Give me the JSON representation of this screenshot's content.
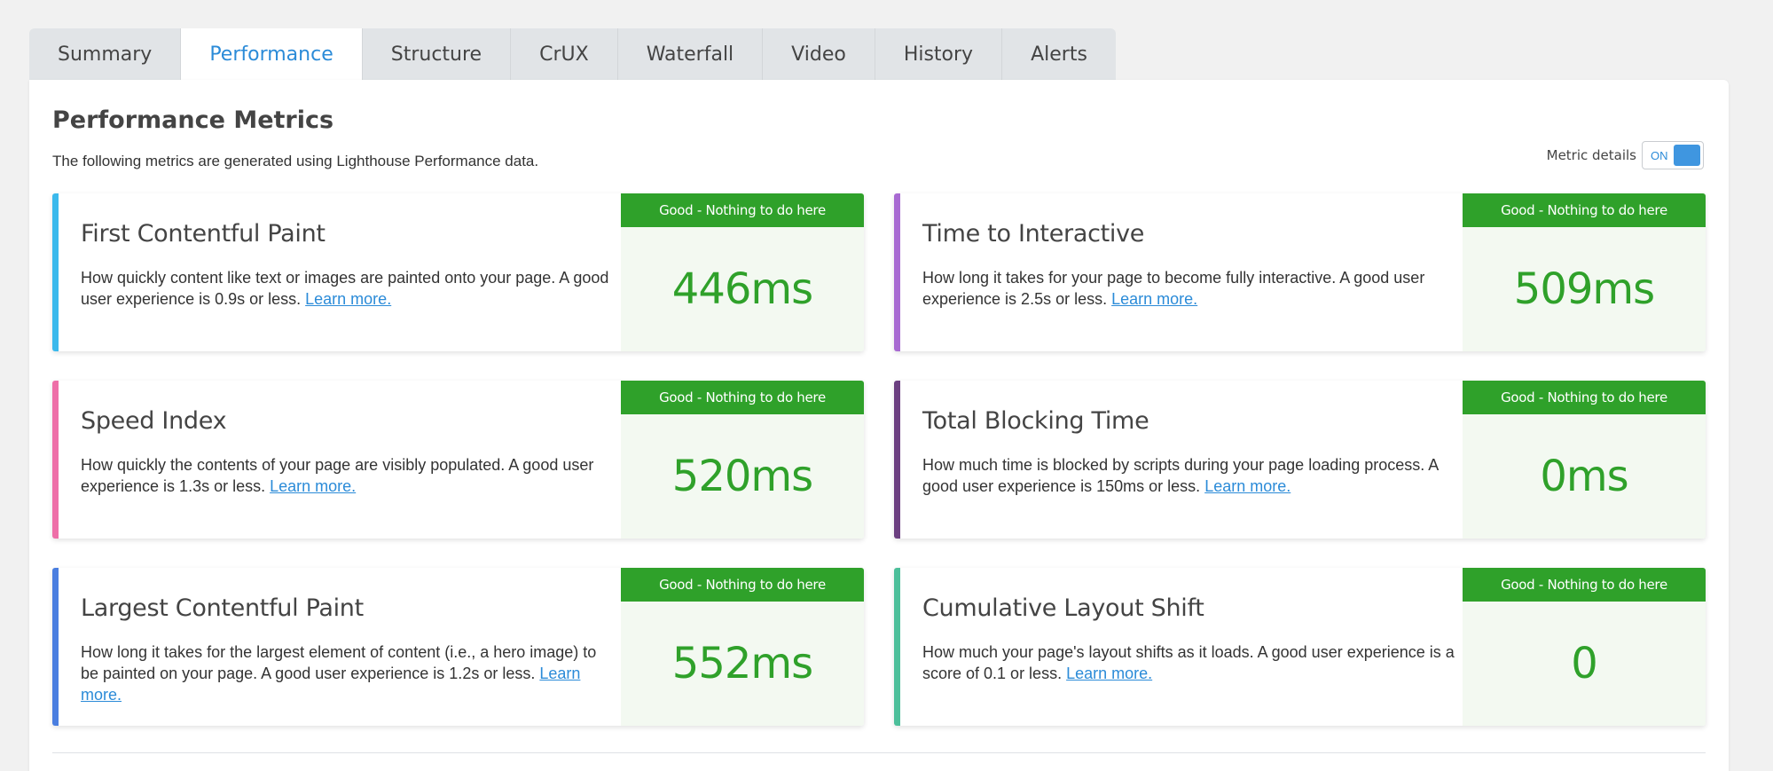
{
  "tabs": [
    "Summary",
    "Performance",
    "Structure",
    "CrUX",
    "Waterfall",
    "Video",
    "History",
    "Alerts"
  ],
  "active_tab": "Performance",
  "panel": {
    "title": "Performance Metrics",
    "description": "The following metrics are generated using Lighthouse Performance data.",
    "toggle_label": "Metric details",
    "toggle_state": "ON"
  },
  "cards": [
    {
      "title": "First Contentful Paint",
      "desc": "How quickly content like text or images are painted onto your page. A good user experience is 0.9s or less.",
      "link": "Learn more.",
      "badge": "Good - Nothing to do here",
      "value": "446ms",
      "accent": "#3bb9ec"
    },
    {
      "title": "Time to Interactive",
      "desc": "How long it takes for your page to become fully interactive. A good user experience is 2.5s or less.",
      "link": "Learn more.",
      "badge": "Good - Nothing to do here",
      "value": "509ms",
      "accent": "#a86ad2"
    },
    {
      "title": "Speed Index",
      "desc": "How quickly the contents of your page are visibly populated. A good user experience is 1.3s or less.",
      "link": "Learn more.",
      "badge": "Good - Nothing to do here",
      "value": "520ms",
      "accent": "#ee6fa8"
    },
    {
      "title": "Total Blocking Time",
      "desc": "How much time is blocked by scripts during your page loading process. A good user experience is 150ms or less.",
      "link": "Learn more.",
      "badge": "Good - Nothing to do here",
      "value": "0ms",
      "accent": "#6b3f80"
    },
    {
      "title": "Largest Contentful Paint",
      "desc": "How long it takes for the largest element of content (i.e., a hero image) to be painted on your page. A good user experience is 1.2s or less.",
      "link": "Learn more.",
      "badge": "Good - Nothing to do here",
      "value": "552ms",
      "accent": "#4a7ee0"
    },
    {
      "title": "Cumulative Layout Shift",
      "desc": "How much your page's layout shifts as it loads. A good user experience is a score of 0.1 or less.",
      "link": "Learn more.",
      "badge": "Good - Nothing to do here",
      "value": "0",
      "accent": "#4cbf9a"
    }
  ]
}
